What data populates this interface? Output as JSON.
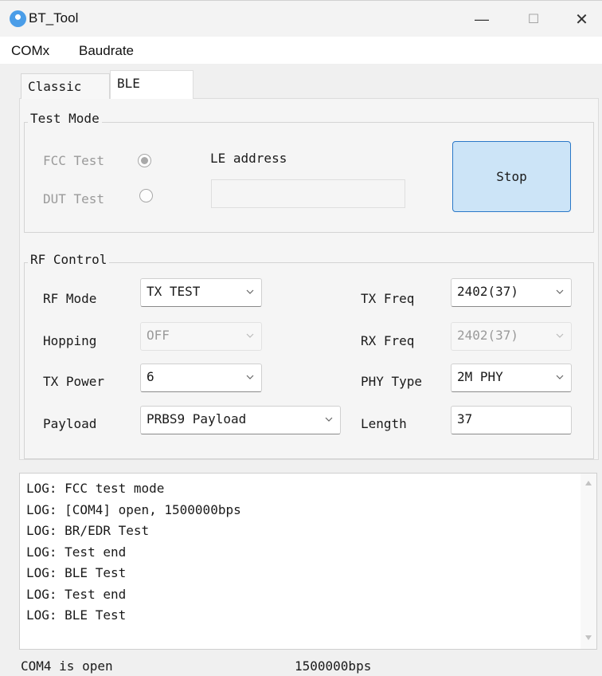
{
  "window": {
    "title": "BT_Tool",
    "minimize_glyph": "—",
    "maximize_glyph": "☐",
    "close_glyph": "✕"
  },
  "menu": {
    "items": [
      "COMx",
      "Baudrate"
    ]
  },
  "tabs": [
    {
      "label": "Classic",
      "selected": false
    },
    {
      "label": "BLE",
      "selected": true
    }
  ],
  "test_mode": {
    "title": "Test Mode",
    "fcc_label": "FCC Test",
    "fcc_checked": true,
    "dut_label": "DUT Test",
    "dut_checked": false,
    "le_address_label": "LE address",
    "le_address_value": "",
    "stop_label": "Stop"
  },
  "rf_control": {
    "title": "RF Control",
    "rf_mode": {
      "label": "RF Mode",
      "value": "TX TEST"
    },
    "hopping": {
      "label": "Hopping",
      "value": "OFF"
    },
    "tx_power": {
      "label": "TX Power",
      "value": "6"
    },
    "payload": {
      "label": "Payload",
      "value": "PRBS9 Payload"
    },
    "tx_freq": {
      "label": "TX Freq",
      "value": "2402(37)"
    },
    "rx_freq": {
      "label": "RX Freq",
      "value": "2402(37)"
    },
    "phy_type": {
      "label": "PHY Type",
      "value": "2M PHY"
    },
    "length": {
      "label": "Length",
      "value": "37"
    }
  },
  "log": {
    "lines": [
      "LOG: FCC test mode",
      "LOG: [COM4] open, 1500000bps",
      "LOG: BR/EDR Test",
      "LOG: Test end",
      "LOG: BLE Test",
      "LOG: Test end",
      "LOG: BLE Test"
    ]
  },
  "status": {
    "port": "COM4 is open",
    "baud": "1500000bps"
  },
  "colors": {
    "button_fill": "#cce4f7",
    "button_border": "#2a78c8",
    "app_icon": "#4a9de8"
  }
}
